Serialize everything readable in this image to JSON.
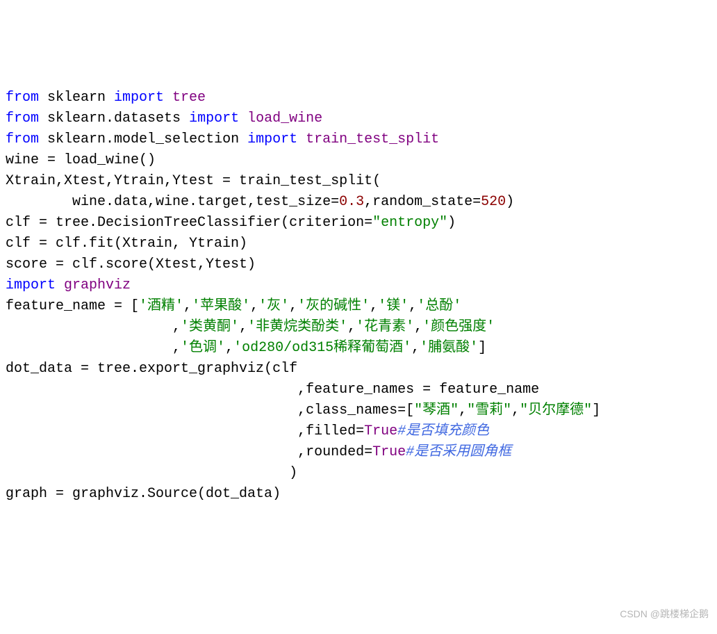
{
  "code": {
    "lines": [
      {
        "parts": [
          {
            "t": "from ",
            "c": "kw-blue"
          },
          {
            "t": "sklearn ",
            "c": ""
          },
          {
            "t": "import ",
            "c": "kw-blue"
          },
          {
            "t": "tree",
            "c": "kw-purple"
          }
        ]
      },
      {
        "parts": [
          {
            "t": "from ",
            "c": "kw-blue"
          },
          {
            "t": "sklearn",
            "c": ""
          },
          {
            "t": ".",
            "c": ""
          },
          {
            "t": "datasets ",
            "c": ""
          },
          {
            "t": "import ",
            "c": "kw-blue"
          },
          {
            "t": "load_wine",
            "c": "kw-purple"
          }
        ]
      },
      {
        "parts": [
          {
            "t": "from ",
            "c": "kw-blue"
          },
          {
            "t": "sklearn",
            "c": ""
          },
          {
            "t": ".",
            "c": ""
          },
          {
            "t": "model_selection ",
            "c": ""
          },
          {
            "t": "import ",
            "c": "kw-blue"
          },
          {
            "t": "train_test_split",
            "c": "kw-purple"
          }
        ]
      },
      {
        "parts": [
          {
            "t": "wine = load_wine()",
            "c": ""
          }
        ]
      },
      {
        "parts": [
          {
            "t": "Xtrain,Xtest,Ytrain,Ytest = train_test_split(",
            "c": ""
          }
        ]
      },
      {
        "parts": [
          {
            "t": "        wine.data,wine.target,test_size=",
            "c": ""
          },
          {
            "t": "0.3",
            "c": "num"
          },
          {
            "t": ",random_state=",
            "c": ""
          },
          {
            "t": "520",
            "c": "num"
          },
          {
            "t": ")",
            "c": ""
          }
        ]
      },
      {
        "parts": [
          {
            "t": "clf = tree.DecisionTreeClassifier(criterion=",
            "c": ""
          },
          {
            "t": "\"entropy\"",
            "c": "str"
          },
          {
            "t": ")",
            "c": ""
          }
        ]
      },
      {
        "parts": [
          {
            "t": "clf = clf.fit(Xtrain, Ytrain)",
            "c": ""
          }
        ]
      },
      {
        "parts": [
          {
            "t": "score = clf.score(Xtest,Ytest)",
            "c": ""
          }
        ]
      },
      {
        "parts": [
          {
            "t": "import ",
            "c": "kw-blue"
          },
          {
            "t": "graphviz",
            "c": "kw-purple"
          }
        ]
      },
      {
        "parts": [
          {
            "t": "feature_name = [",
            "c": ""
          },
          {
            "t": "'酒精'",
            "c": "str"
          },
          {
            "t": ",",
            "c": ""
          },
          {
            "t": "'苹果酸'",
            "c": "str"
          },
          {
            "t": ",",
            "c": ""
          },
          {
            "t": "'灰'",
            "c": "str"
          },
          {
            "t": ",",
            "c": ""
          },
          {
            "t": "'灰的碱性'",
            "c": "str"
          },
          {
            "t": ",",
            "c": ""
          },
          {
            "t": "'镁'",
            "c": "str"
          },
          {
            "t": ",",
            "c": ""
          },
          {
            "t": "'总酚'",
            "c": "str"
          }
        ]
      },
      {
        "parts": [
          {
            "t": "                    ,",
            "c": ""
          },
          {
            "t": "'类黄酮'",
            "c": "str"
          },
          {
            "t": ",",
            "c": ""
          },
          {
            "t": "'非黄烷类酚类'",
            "c": "str"
          },
          {
            "t": ",",
            "c": ""
          },
          {
            "t": "'花青素'",
            "c": "str"
          },
          {
            "t": ",",
            "c": ""
          },
          {
            "t": "'颜色强度'",
            "c": "str"
          }
        ]
      },
      {
        "parts": [
          {
            "t": "                    ,",
            "c": ""
          },
          {
            "t": "'色调'",
            "c": "str"
          },
          {
            "t": ",",
            "c": ""
          },
          {
            "t": "'od280/od315稀释葡萄酒'",
            "c": "str"
          },
          {
            "t": ",",
            "c": ""
          },
          {
            "t": "'脯氨酸'",
            "c": "str"
          },
          {
            "t": "]",
            "c": ""
          }
        ]
      },
      {
        "parts": [
          {
            "t": "dot_data = tree.export_graphviz(clf",
            "c": ""
          }
        ]
      },
      {
        "parts": [
          {
            "t": "                                   ,feature_names = feature_name",
            "c": ""
          }
        ]
      },
      {
        "parts": [
          {
            "t": "                                   ,class_names=[",
            "c": ""
          },
          {
            "t": "\"琴酒\"",
            "c": "str"
          },
          {
            "t": ",",
            "c": ""
          },
          {
            "t": "\"雪莉\"",
            "c": "str"
          },
          {
            "t": ",",
            "c": ""
          },
          {
            "t": "\"贝尔摩德\"",
            "c": "str"
          },
          {
            "t": "]",
            "c": ""
          }
        ]
      },
      {
        "parts": [
          {
            "t": "                                   ,filled=",
            "c": ""
          },
          {
            "t": "True",
            "c": "kw-purple"
          },
          {
            "t": "#是否填充颜色",
            "c": "comment"
          }
        ]
      },
      {
        "parts": [
          {
            "t": "                                   ,rounded=",
            "c": ""
          },
          {
            "t": "True",
            "c": "kw-purple"
          },
          {
            "t": "#是否采用圆角框",
            "c": "comment"
          }
        ]
      },
      {
        "parts": [
          {
            "t": "                                  )",
            "c": ""
          }
        ]
      },
      {
        "parts": [
          {
            "t": "graph = graphviz.Source(dot_data)",
            "c": ""
          }
        ]
      }
    ]
  },
  "watermark": "CSDN @跳楼梯企鹅"
}
